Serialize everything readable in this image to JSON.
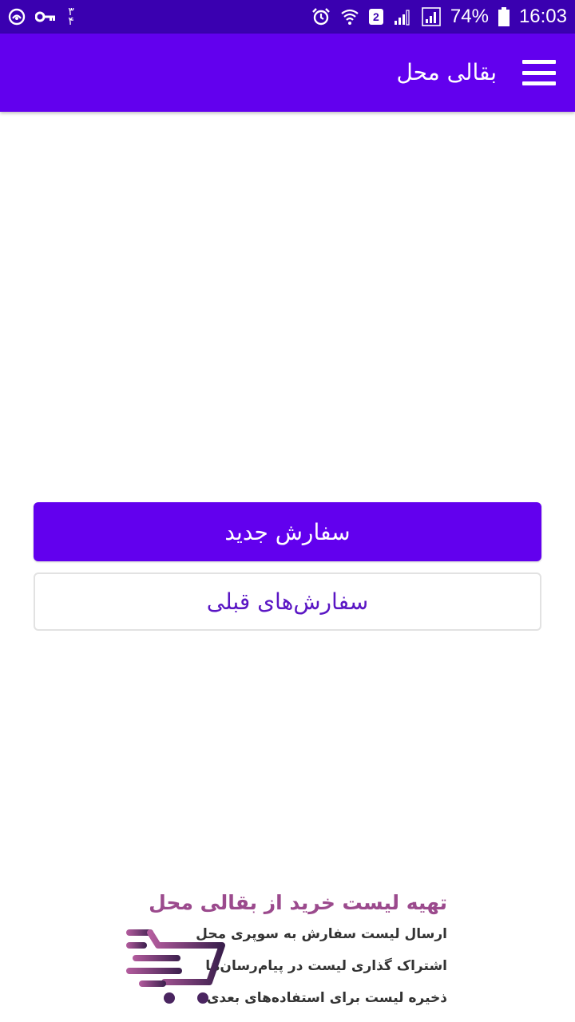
{
  "status_bar": {
    "left_digits": [
      "۳",
      "۴"
    ],
    "sim_label": "2",
    "battery": "74%",
    "time": "16:03",
    "icons": [
      "vpn-icon",
      "key-icon",
      "alarm-icon",
      "wifi-icon",
      "signal-icon",
      "battery-icon"
    ]
  },
  "app_bar": {
    "title": "بقالی محل",
    "menu_icon": "hamburger-menu-icon"
  },
  "actions": {
    "new_order": "سفارش جدید",
    "previous_orders": "سفارش‌های قبلی"
  },
  "promo": {
    "title": "تهیه لیست خرید از بقالی محل",
    "lines": [
      "ارسال لیست سفارش به سوپری محل",
      "اشتراک گذاری لیست در پیام‌رسان‌ها",
      "ذخیره لیست برای استفاده‌های بعدی"
    ],
    "logo_icon": "shopping-cart-icon"
  },
  "colors": {
    "status_bar": "#3a00b0",
    "primary": "#6200ee",
    "outline_text": "#5a16c4",
    "promo_title": "#9b4a8d"
  }
}
